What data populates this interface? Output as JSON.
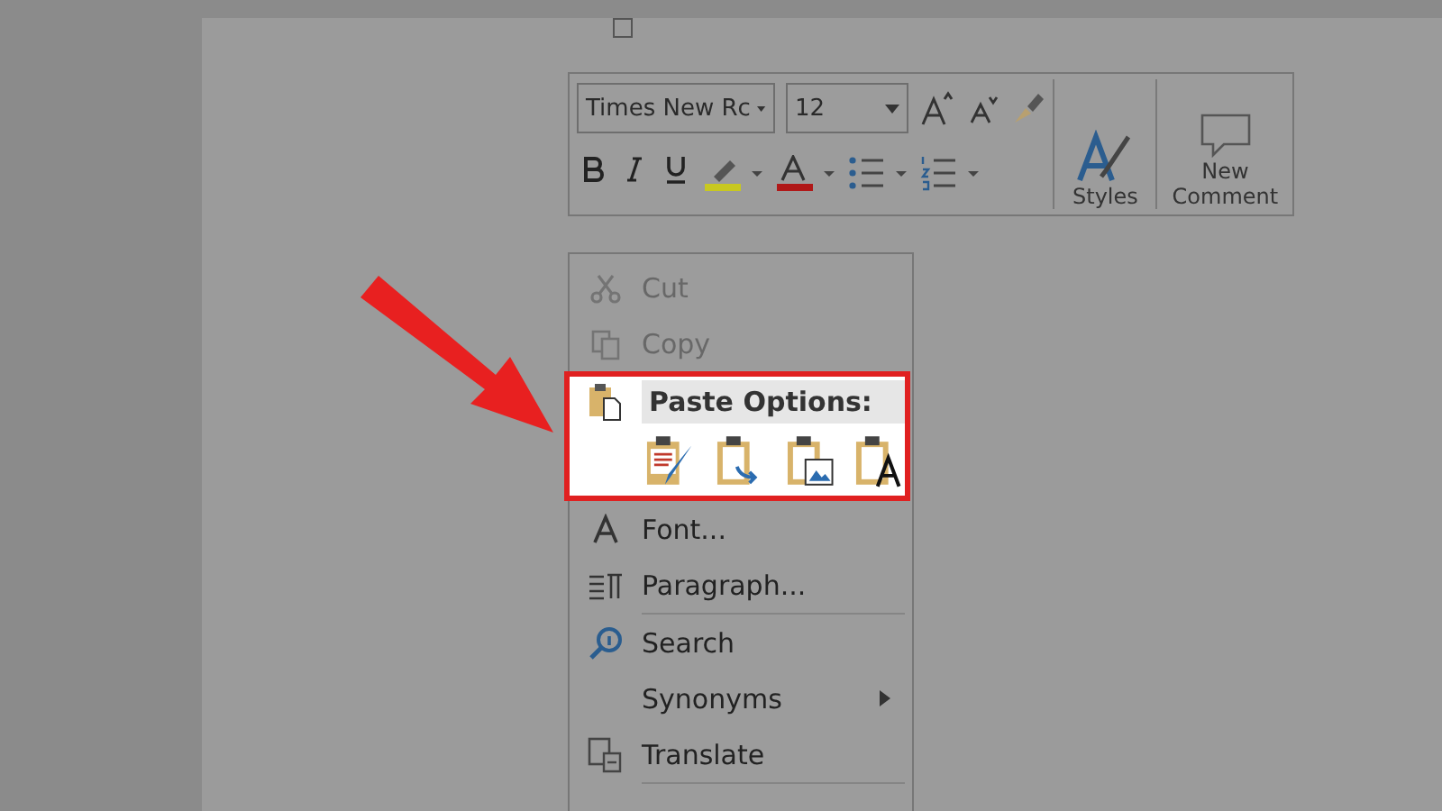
{
  "mini_toolbar": {
    "font": "Times New Rc",
    "size": "12",
    "styles": "Styles",
    "new_comment": "New Comment"
  },
  "context_menu": {
    "items": [
      {
        "kind": "command",
        "label": "Cut",
        "disabled": true
      },
      {
        "kind": "command",
        "label": "Copy",
        "disabled": true
      },
      {
        "kind": "paste",
        "label": "Paste Options:",
        "disabled": false
      },
      {
        "kind": "command",
        "label": "Font...",
        "disabled": false
      },
      {
        "kind": "command",
        "label": "Paragraph...",
        "disabled": false
      },
      {
        "kind": "command",
        "label": "Search",
        "disabled": false
      },
      {
        "kind": "submenu",
        "label": "Synonyms",
        "disabled": false
      },
      {
        "kind": "command",
        "label": "Translate",
        "disabled": false
      }
    ]
  }
}
